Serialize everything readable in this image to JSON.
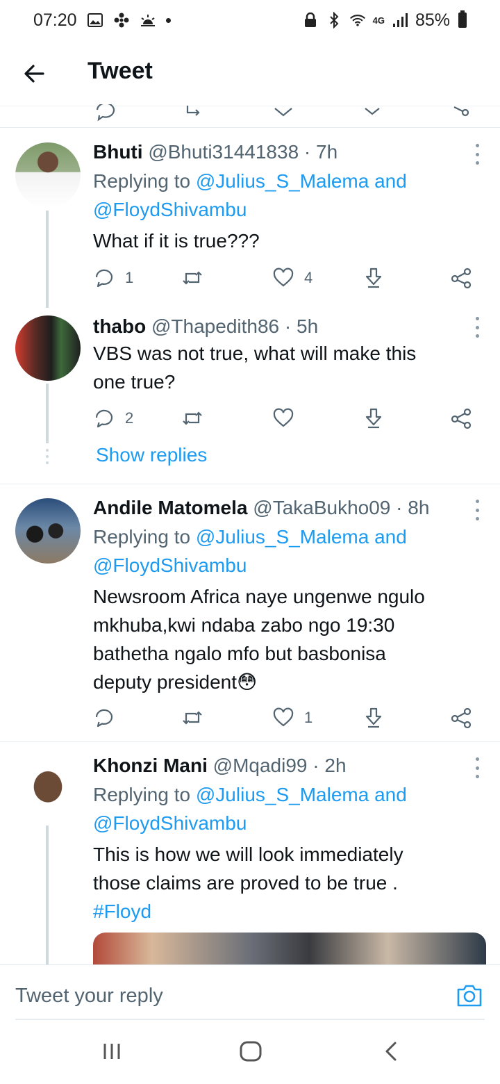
{
  "status_bar": {
    "time": "07:20",
    "battery": "85%",
    "network": "4G"
  },
  "header": {
    "title": "Tweet"
  },
  "tweets": [
    {
      "name": "Bhuti",
      "handle": "@Bhuti31441838",
      "time": "7h",
      "replying_prefix": "Replying to ",
      "replying_to_1": "@Julius_S_Malema",
      "replying_and": " and",
      "replying_to_2": "@FloydShivambu",
      "text": "What if it is true???",
      "replies": "1",
      "retweets": "",
      "likes": "4"
    },
    {
      "name": "thabo",
      "handle": "@Thapedith86",
      "time": "5h",
      "text_line1": "VBS was not true, what will make this",
      "text_line2": "one true?",
      "replies": "2",
      "retweets": "",
      "likes": ""
    },
    {
      "name": "Andile Matomela",
      "handle": "@TakaBukho09",
      "time": "8h",
      "replying_prefix": "Replying to ",
      "replying_to_1": "@Julius_S_Malema",
      "replying_and": " and",
      "replying_to_2": "@FloydShivambu",
      "text_line1": "Newsroom Africa naye ungenwe ngulo",
      "text_line2": "mkhuba,kwi ndaba zabo ngo 19:30",
      "text_line3": "bathetha ngalo mfo but basbonisa",
      "text_line4": "deputy president",
      "emoji": "😳",
      "replies": "",
      "retweets": "",
      "likes": "1"
    },
    {
      "name": "Khonzi Mani",
      "handle": "@Mqadi99",
      "time": "2h",
      "replying_prefix": "Replying to ",
      "replying_to_1": "@Julius_S_Malema",
      "replying_and": " and",
      "replying_to_2": "@FloydShivambu",
      "text_line1": "This is how we will look immediately",
      "text_line2": "those claims are proved to be true .",
      "hashtag": "#Floyd"
    }
  ],
  "show_replies": "Show replies",
  "composer": {
    "placeholder": "Tweet your reply"
  },
  "colors": {
    "accent": "#1d9bf0",
    "text": "#0f1419",
    "muted": "#536471"
  }
}
